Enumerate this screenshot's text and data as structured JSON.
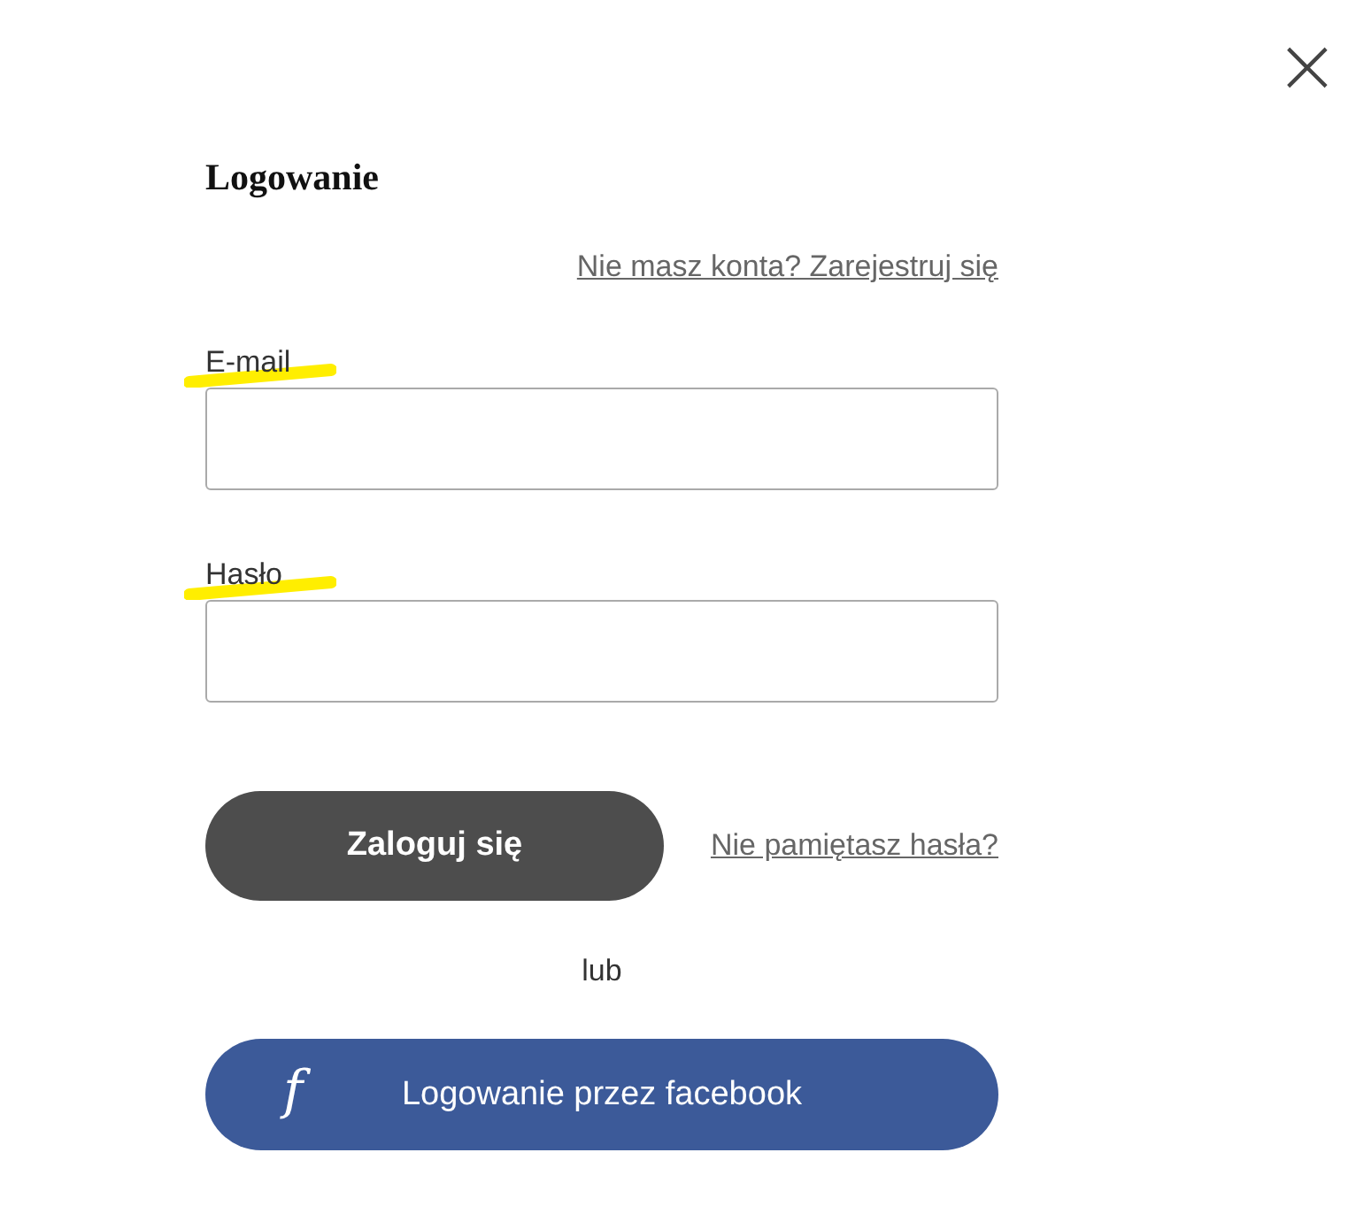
{
  "close_button": {
    "label": "×"
  },
  "title": "Logowanie",
  "register_link": "Nie masz konta? Zarejestruj się",
  "fields": [
    {
      "label": "E-mail",
      "highlighted": true
    },
    {
      "label": "Hasło",
      "highlighted": true
    }
  ],
  "login_button": "Zaloguj się",
  "forgot_link": "Nie pamiętasz hasła?",
  "separator": "lub",
  "facebook_button": {
    "label": "Logowanie przez facebook",
    "icon": "f"
  }
}
